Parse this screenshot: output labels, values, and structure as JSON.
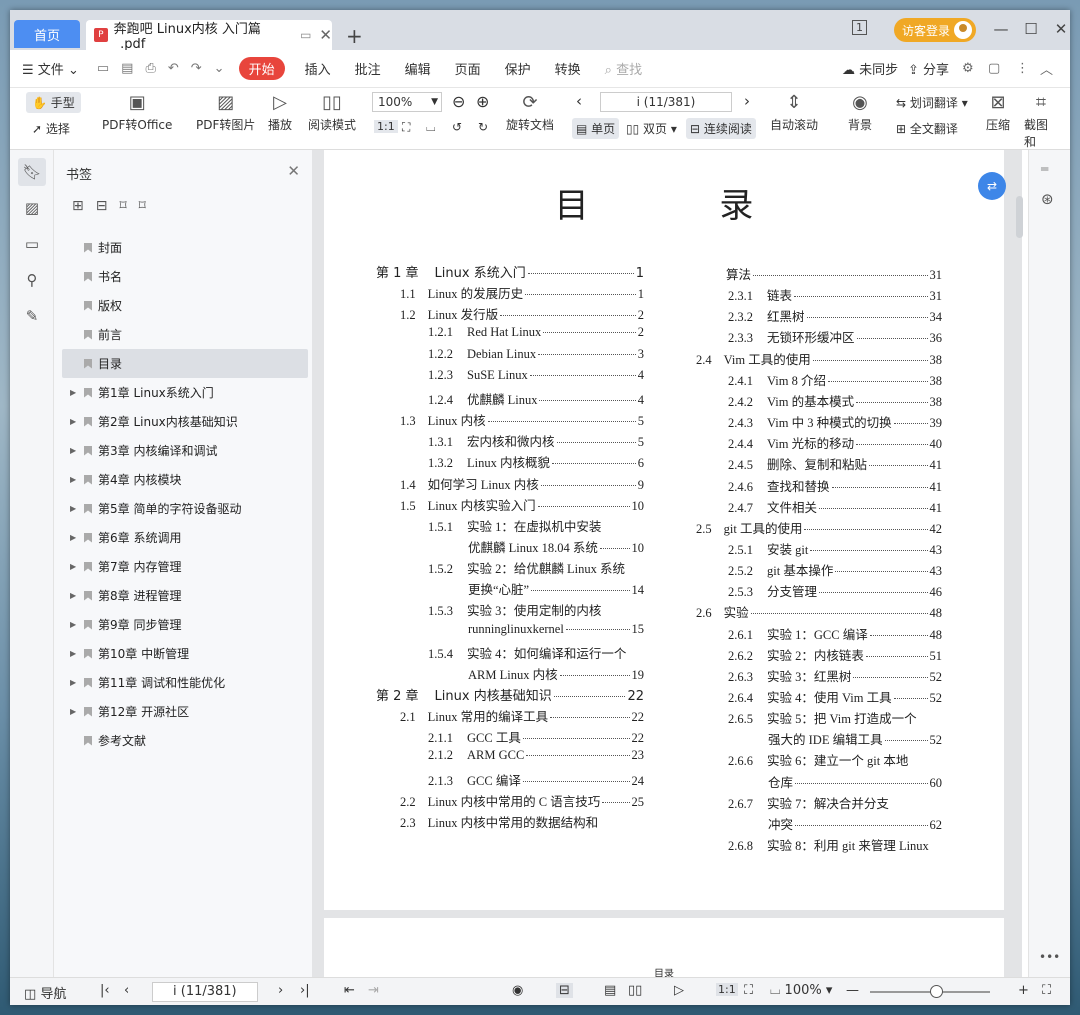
{
  "tabs": {
    "home": "首页",
    "doc": "奔跑吧 Linux内核 入门篇_.pdf",
    "login": "访客登录"
  },
  "menu": {
    "file": "文件",
    "start": "开始",
    "items": [
      "插入",
      "批注",
      "编辑",
      "页面",
      "保护",
      "转换"
    ],
    "search": "查找",
    "unsync": "未同步",
    "share": "分享"
  },
  "toolbar": {
    "hand": "手型",
    "select": "选择",
    "pdf_office": "PDF转Office",
    "pdf_image": "PDF转图片",
    "play": "播放",
    "read_mode": "阅读模式",
    "zoom": "100%",
    "page": "i (11/381)",
    "rotate": "旋转文档",
    "single": "单页",
    "double": "双页",
    "continuous": "连续阅读",
    "auto_scroll": "自动滚动",
    "bg": "背景",
    "word_translate": "划词翻译",
    "full_translate": "全文翻译",
    "compress": "压缩",
    "screenshot": "截图和"
  },
  "bookmarks": {
    "title": "书签",
    "items": [
      {
        "label": "封面",
        "arrow": false
      },
      {
        "label": "书名",
        "arrow": false
      },
      {
        "label": "版权",
        "arrow": false
      },
      {
        "label": "前言",
        "arrow": false
      },
      {
        "label": "目录",
        "arrow": false,
        "selected": true
      },
      {
        "label": "第1章  Linux系统入门",
        "arrow": true
      },
      {
        "label": "第2章  Linux内核基础知识",
        "arrow": true
      },
      {
        "label": "第3章  内核编译和调试",
        "arrow": true
      },
      {
        "label": "第4章  内核模块",
        "arrow": true
      },
      {
        "label": "第5章  简单的字符设备驱动",
        "arrow": true
      },
      {
        "label": "第6章  系统调用",
        "arrow": true
      },
      {
        "label": "第7章  内存管理",
        "arrow": true
      },
      {
        "label": "第8章  进程管理",
        "arrow": true
      },
      {
        "label": "第9章  同步管理",
        "arrow": true
      },
      {
        "label": "第10章  中断管理",
        "arrow": true
      },
      {
        "label": "第11章  调试和性能优化",
        "arrow": true
      },
      {
        "label": "第12章  开源社区",
        "arrow": true
      },
      {
        "label": "参考文献",
        "arrow": false
      }
    ]
  },
  "page_title": "目  录",
  "toc_left": [
    {
      "num": "第 1 章",
      "text": "Linux 系统入门",
      "page": "1",
      "level": 0,
      "dots": true
    },
    {
      "num": "1.1",
      "text": "Linux 的发展历史",
      "page": "1",
      "level": 1,
      "dots": true
    },
    {
      "num": "1.2",
      "text": "Linux 发行版",
      "page": "2",
      "level": 1,
      "dots": true
    },
    {
      "num": "1.2.1",
      "text": "Red Hat Linux",
      "page": "2",
      "level": 2,
      "dots": true
    },
    {
      "num": "1.2.2",
      "text": "Debian Linux",
      "page": "3",
      "level": 2,
      "dots": true
    },
    {
      "num": "1.2.3",
      "text": "SuSE Linux",
      "page": "4",
      "level": 2,
      "dots": true
    },
    {
      "num": "1.2.4",
      "text": "优麒麟 Linux",
      "page": "4",
      "level": 2,
      "dots": true
    },
    {
      "num": "1.3",
      "text": "Linux 内核",
      "page": "5",
      "level": 1,
      "dots": true
    },
    {
      "num": "1.3.1",
      "text": "宏内核和微内核",
      "page": "5",
      "level": 2,
      "dots": true
    },
    {
      "num": "1.3.2",
      "text": "Linux 内核概貌",
      "page": "6",
      "level": 2,
      "dots": true
    },
    {
      "num": "1.4",
      "text": "如何学习 Linux 内核",
      "page": "9",
      "level": 1,
      "dots": true
    },
    {
      "num": "1.5",
      "text": "Linux 内核实验入门",
      "page": "10",
      "level": 1,
      "dots": true
    },
    {
      "num": "1.5.1",
      "text": "实验 1：在虚拟机中安装",
      "page": "",
      "level": 2,
      "dots": false
    },
    {
      "num": "",
      "text": "优麒麟 Linux 18.04 系统",
      "page": "10",
      "level": 3,
      "dots": true
    },
    {
      "num": "1.5.2",
      "text": "实验 2：给优麒麟 Linux 系统",
      "page": "",
      "level": 2,
      "dots": false
    },
    {
      "num": "",
      "text": "更换“心脏”",
      "page": "14",
      "level": 3,
      "dots": true
    },
    {
      "num": "1.5.3",
      "text": "实验 3：使用定制的内核",
      "page": "",
      "level": 2,
      "dots": false
    },
    {
      "num": "",
      "text": "runninglinuxkernel",
      "page": "15",
      "level": 3,
      "dots": true
    },
    {
      "num": "1.5.4",
      "text": "实验 4：如何编译和运行一个",
      "page": "",
      "level": 2,
      "dots": false
    },
    {
      "num": "",
      "text": "ARM Linux 内核",
      "page": "19",
      "level": 3,
      "dots": true
    },
    {
      "num": "第 2 章",
      "text": "Linux 内核基础知识",
      "page": "22",
      "level": 0,
      "dots": true
    },
    {
      "num": "2.1",
      "text": "Linux 常用的编译工具",
      "page": "22",
      "level": 1,
      "dots": true
    },
    {
      "num": "2.1.1",
      "text": "GCC 工具",
      "page": "22",
      "level": 2,
      "dots": true
    },
    {
      "num": "2.1.2",
      "text": "ARM GCC",
      "page": "23",
      "level": 2,
      "dots": true
    },
    {
      "num": "2.1.3",
      "text": "GCC 编译",
      "page": "24",
      "level": 2,
      "dots": true
    },
    {
      "num": "2.2",
      "text": "Linux 内核中常用的 C 语言技巧",
      "page": "25",
      "level": 1,
      "dots": true
    },
    {
      "num": "2.3",
      "text": "Linux 内核中常用的数据结构和",
      "page": "",
      "level": 1,
      "dots": false
    }
  ],
  "toc_right": [
    {
      "num": "",
      "text": "算法",
      "page": "31",
      "level": 3,
      "dots": true
    },
    {
      "num": "2.3.1",
      "text": "链表",
      "page": "31",
      "level": 2,
      "dots": true
    },
    {
      "num": "2.3.2",
      "text": "红黑树",
      "page": "34",
      "level": 2,
      "dots": true
    },
    {
      "num": "2.3.3",
      "text": "无锁环形缓冲区",
      "page": "36",
      "level": 2,
      "dots": true
    },
    {
      "num": "2.4",
      "text": "Vim 工具的使用",
      "page": "38",
      "level": 1,
      "dots": true
    },
    {
      "num": "2.4.1",
      "text": "Vim 8 介绍",
      "page": "38",
      "level": 2,
      "dots": true
    },
    {
      "num": "2.4.2",
      "text": "Vim 的基本模式",
      "page": "38",
      "level": 2,
      "dots": true
    },
    {
      "num": "2.4.3",
      "text": "Vim 中 3 种模式的切换",
      "page": "39",
      "level": 2,
      "dots": true
    },
    {
      "num": "2.4.4",
      "text": "Vim 光标的移动",
      "page": "40",
      "level": 2,
      "dots": true
    },
    {
      "num": "2.4.5",
      "text": "删除、复制和粘贴",
      "page": "41",
      "level": 2,
      "dots": true
    },
    {
      "num": "2.4.6",
      "text": "查找和替换",
      "page": "41",
      "level": 2,
      "dots": true
    },
    {
      "num": "2.4.7",
      "text": "文件相关",
      "page": "41",
      "level": 2,
      "dots": true
    },
    {
      "num": "2.5",
      "text": "git 工具的使用",
      "page": "42",
      "level": 1,
      "dots": true
    },
    {
      "num": "2.5.1",
      "text": "安装 git",
      "page": "43",
      "level": 2,
      "dots": true
    },
    {
      "num": "2.5.2",
      "text": "git 基本操作",
      "page": "43",
      "level": 2,
      "dots": true
    },
    {
      "num": "2.5.3",
      "text": "分支管理",
      "page": "46",
      "level": 2,
      "dots": true
    },
    {
      "num": "2.6",
      "text": "实验",
      "page": "48",
      "level": 1,
      "dots": true
    },
    {
      "num": "2.6.1",
      "text": "实验 1：GCC 编译",
      "page": "48",
      "level": 2,
      "dots": true
    },
    {
      "num": "2.6.2",
      "text": "实验 2：内核链表",
      "page": "51",
      "level": 2,
      "dots": true
    },
    {
      "num": "2.6.3",
      "text": "实验 3：红黑树",
      "page": "52",
      "level": 2,
      "dots": true
    },
    {
      "num": "2.6.4",
      "text": "实验 4：使用 Vim 工具",
      "page": "52",
      "level": 2,
      "dots": true
    },
    {
      "num": "2.6.5",
      "text": "实验 5：把 Vim 打造成一个",
      "page": "",
      "level": 2,
      "dots": false
    },
    {
      "num": "",
      "text": "强大的 IDE 编辑工具",
      "page": "52",
      "level": 3,
      "dots": true
    },
    {
      "num": "2.6.6",
      "text": "实验 6：建立一个 git 本地",
      "page": "",
      "level": 2,
      "dots": false
    },
    {
      "num": "",
      "text": "仓库",
      "page": "60",
      "level": 3,
      "dots": true
    },
    {
      "num": "2.6.7",
      "text": "实验 7：解决合并分支",
      "page": "",
      "level": 2,
      "dots": false
    },
    {
      "num": "",
      "text": "冲突",
      "page": "62",
      "level": 3,
      "dots": true
    },
    {
      "num": "2.6.8",
      "text": "实验 8：利用 git 来管理 Linux",
      "page": "",
      "level": 2,
      "dots": false
    }
  ],
  "page2_header": "目录",
  "status": {
    "nav": "导航",
    "page": "i (11/381)",
    "zoom": "100%"
  }
}
